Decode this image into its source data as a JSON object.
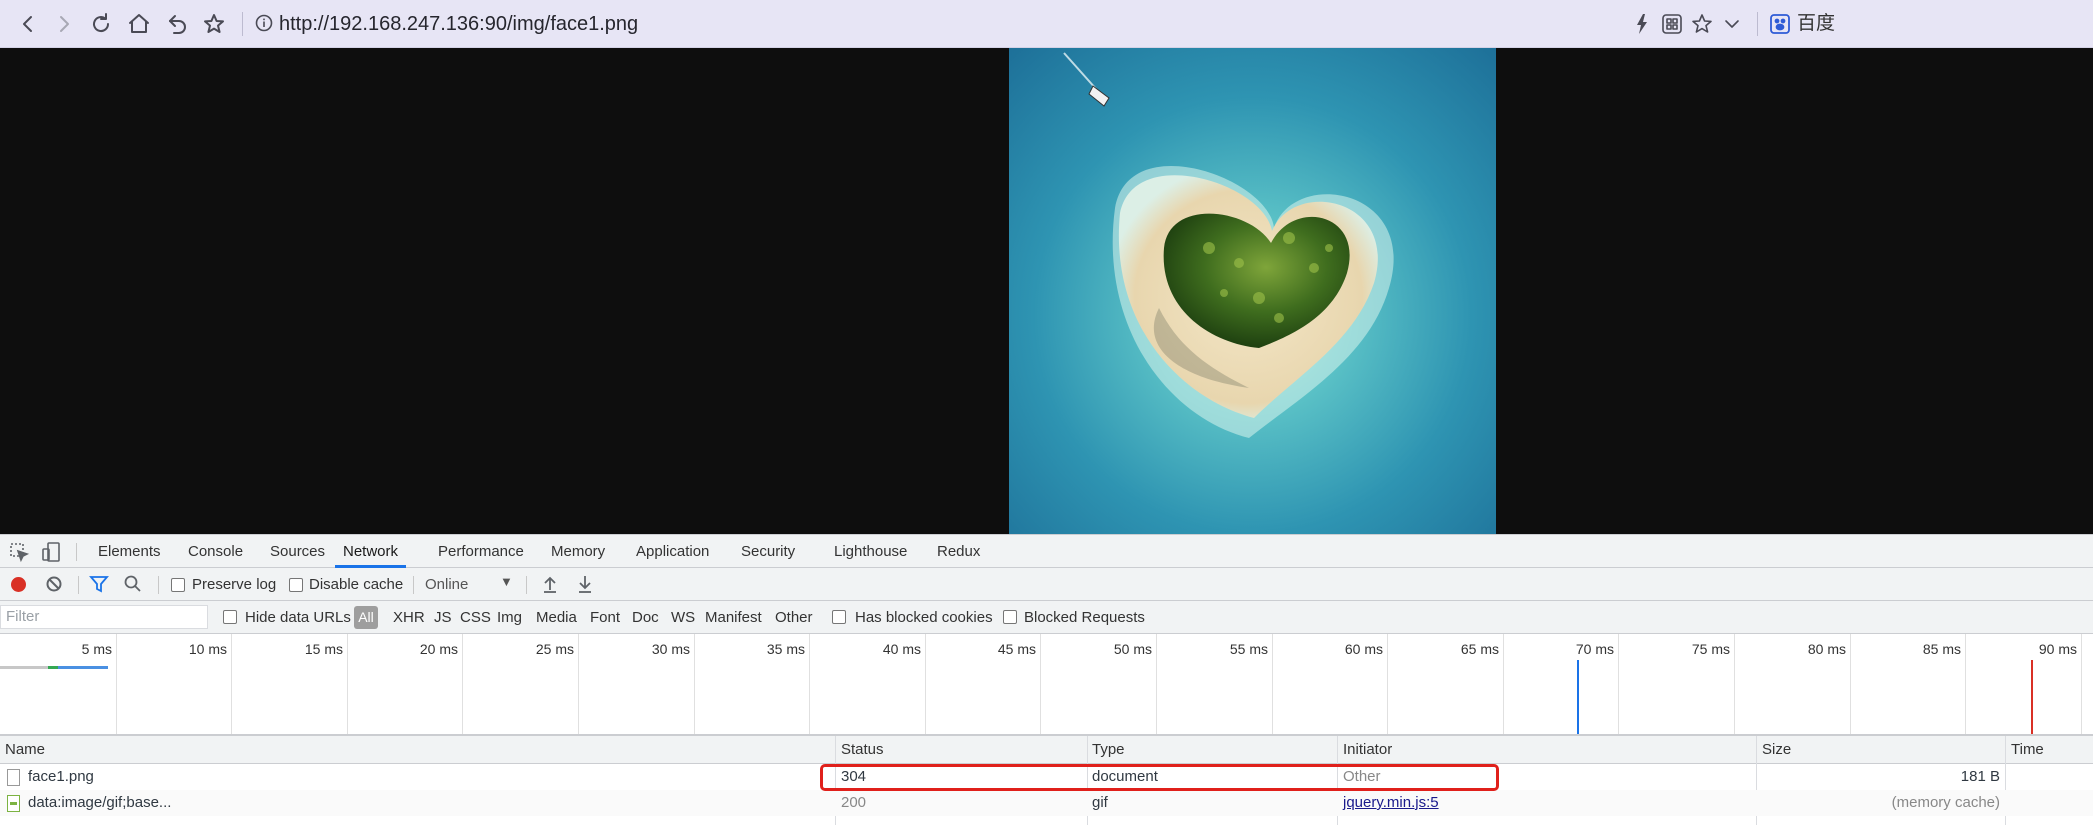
{
  "browser": {
    "url": "http://192.168.247.136:90/img/face1.png",
    "search_engine_label": "百度",
    "icons": [
      "back-icon",
      "forward-icon",
      "reload-icon",
      "home-icon",
      "undo-icon",
      "bookmark-star-icon",
      "info-icon",
      "lightning-icon",
      "qr-icon",
      "star-icon",
      "chevron-down-icon",
      "baidu-paw-icon"
    ]
  },
  "viewport": {
    "image_alt": "heart-shaped island"
  },
  "devtools": {
    "tabs": [
      "Elements",
      "Console",
      "Sources",
      "Network",
      "Performance",
      "Memory",
      "Application",
      "Security",
      "Lighthouse",
      "Redux"
    ],
    "active_tab": "Network",
    "toolbar": {
      "preserve_log": "Preserve log",
      "disable_cache": "Disable cache",
      "throttle": "Online"
    },
    "filter": {
      "placeholder": "Filter",
      "hide_data_urls": "Hide data URLs",
      "all": "All",
      "types": [
        "XHR",
        "JS",
        "CSS",
        "Img",
        "Media",
        "Font",
        "Doc",
        "WS",
        "Manifest",
        "Other"
      ],
      "has_blocked_cookies": "Has blocked cookies",
      "blocked_requests": "Blocked Requests"
    },
    "timeline": {
      "ticks": [
        "5 ms",
        "10 ms",
        "15 ms",
        "20 ms",
        "25 ms",
        "30 ms",
        "35 ms",
        "40 ms",
        "45 ms",
        "50 ms",
        "55 ms",
        "60 ms",
        "65 ms",
        "70 ms",
        "75 ms",
        "80 ms",
        "85 ms",
        "90 ms"
      ],
      "dom_content_loaded_color": "#1a73e8",
      "load_color": "#d93025"
    },
    "columns": [
      "Name",
      "Status",
      "Type",
      "Initiator",
      "Size",
      "Time"
    ],
    "rows": [
      {
        "name": "face1.png",
        "status": "304",
        "type": "document",
        "initiator": "Other",
        "size": "181 B",
        "time": ""
      },
      {
        "name": "data:image/gif;base...",
        "status": "200",
        "type": "gif",
        "initiator": "jquery.min.js:5",
        "size": "(memory cache)",
        "time": ""
      }
    ],
    "highlight_color": "#e0201b"
  }
}
